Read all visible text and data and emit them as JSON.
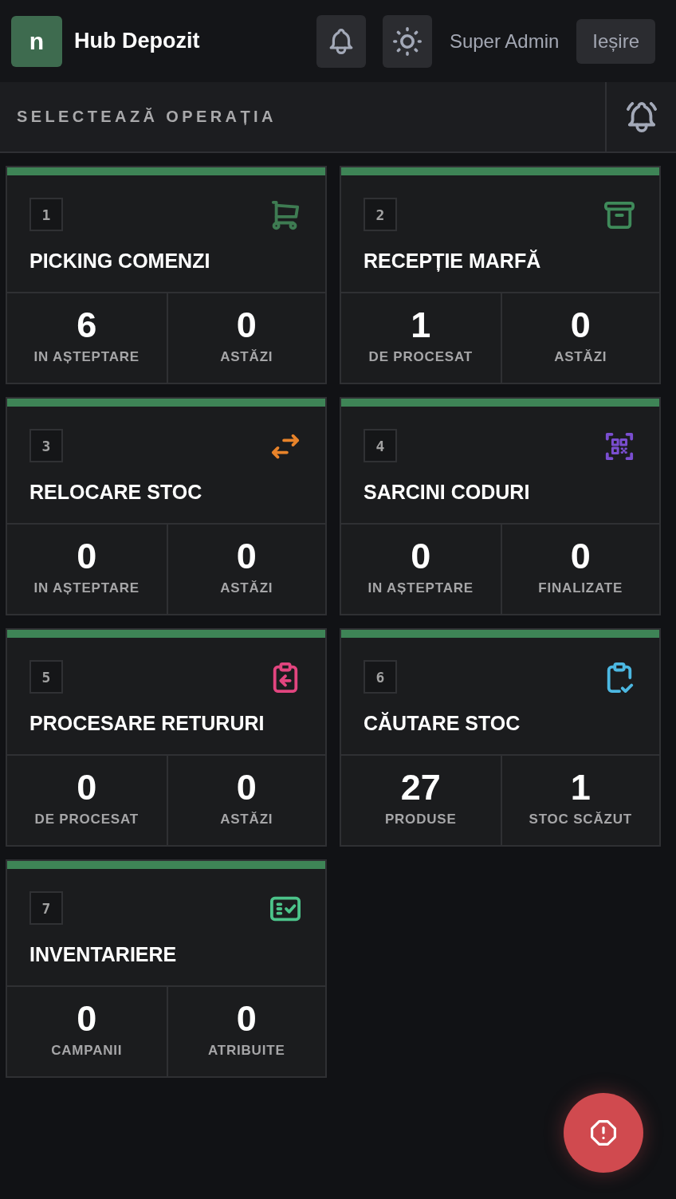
{
  "header": {
    "logo_letter": "n",
    "title": "Hub Depozit",
    "user": "Super Admin",
    "logout": "Ieșire"
  },
  "section": {
    "title": "SELECTEAZĂ OPERAȚIA"
  },
  "operations": [
    {
      "number": "1",
      "title": "PICKING COMENZI",
      "color": "#3e7b52",
      "stats": [
        {
          "value": "6",
          "label": "IN AȘTEPTARE"
        },
        {
          "value": "0",
          "label": "ASTĂZI"
        }
      ]
    },
    {
      "number": "2",
      "title": "RECEPȚIE MARFĂ",
      "color": "#3f8a5a",
      "stats": [
        {
          "value": "1",
          "label": "DE PROCESAT"
        },
        {
          "value": "0",
          "label": "ASTĂZI"
        }
      ]
    },
    {
      "number": "3",
      "title": "RELOCARE STOC",
      "color": "#e8832a",
      "stats": [
        {
          "value": "0",
          "label": "IN AȘTEPTARE"
        },
        {
          "value": "0",
          "label": "ASTĂZI"
        }
      ]
    },
    {
      "number": "4",
      "title": "SARCINI CODURI",
      "color": "#7a4ed0",
      "stats": [
        {
          "value": "0",
          "label": "IN AȘTEPTARE"
        },
        {
          "value": "0",
          "label": "FINALIZATE"
        }
      ]
    },
    {
      "number": "5",
      "title": "PROCESARE RETURURI",
      "color": "#e2457f",
      "stats": [
        {
          "value": "0",
          "label": "DE PROCESAT"
        },
        {
          "value": "0",
          "label": "ASTĂZI"
        }
      ]
    },
    {
      "number": "6",
      "title": "CĂUTARE STOC",
      "color": "#4cb8e2",
      "stats": [
        {
          "value": "27",
          "label": "PRODUSE"
        },
        {
          "value": "1",
          "label": "STOC SCĂZUT"
        }
      ]
    },
    {
      "number": "7",
      "title": "INVENTARIERE",
      "color": "#4cc38a",
      "stats": [
        {
          "value": "0",
          "label": "CAMPANII"
        },
        {
          "value": "0",
          "label": "ATRIBUITE"
        }
      ]
    }
  ]
}
